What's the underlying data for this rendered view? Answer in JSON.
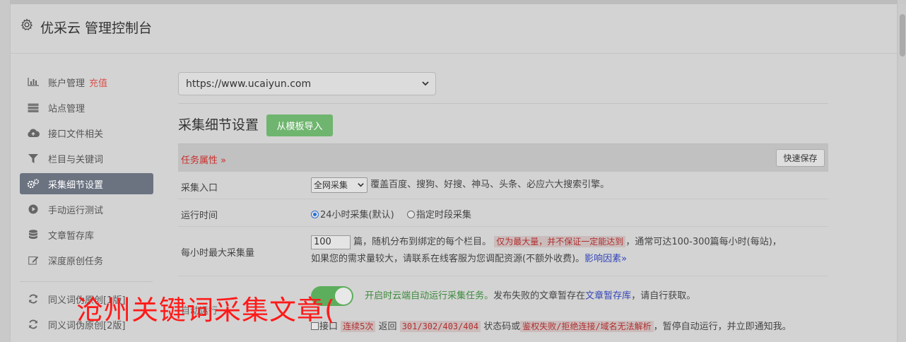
{
  "header": {
    "title": "优采云 管理控制台",
    "icon": "gear-icon"
  },
  "sidebar": {
    "items": [
      {
        "label": "账户管理",
        "badge": "充值",
        "icon": "bar-chart-icon"
      },
      {
        "label": "站点管理",
        "icon": "server-icon"
      },
      {
        "label": "接口文件相关",
        "icon": "cloud-upload-icon"
      },
      {
        "label": "栏目与关键词",
        "icon": "filter-icon"
      },
      {
        "label": "采集细节设置",
        "icon": "cogs-icon",
        "active": true
      },
      {
        "label": "手动运行测试",
        "icon": "play-circle-icon"
      },
      {
        "label": "文章暂存库",
        "icon": "database-icon"
      },
      {
        "label": "深度原创任务",
        "icon": "edit-icon"
      }
    ],
    "items2": [
      {
        "label": "同义词伪原创[1版]",
        "icon": "refresh-icon"
      },
      {
        "label": "同义词伪原创[2版]",
        "icon": "refresh-icon"
      }
    ]
  },
  "main": {
    "site_select": "https://www.ucaiyun.com",
    "section_title": "采集细节设置",
    "import_button": "从模板导入",
    "task_attr_label": "任务属性 »",
    "quick_save_button": "快速保存",
    "rows": {
      "entry": {
        "label": "采集入口",
        "select_value": "全网采集",
        "desc": "覆盖百度、搜狗、好搜、神马、头条、必应六大搜索引擎。"
      },
      "runtime": {
        "label": "运行时间",
        "option1": "24小时采集(默认)",
        "option2": "指定时段采集"
      },
      "max": {
        "label": "每小时最大采集量",
        "value": "100",
        "text1": "篇，随机分布到绑定的每个栏目。",
        "tag": "仅为最大量，并不保证一定能达到",
        "text2": "，通常可达100-300篇每小时(每站)，",
        "text3": "如果您的需求量较大，请联系在线客服为您调配资源(不额外收费)。",
        "link": "影响因素»"
      },
      "auto": {
        "label": "自动运行",
        "text_green": "开启时云端自动运行采集任务。",
        "text1": "发布失败的文章暂存在",
        "link": "文章暂存库",
        "text2": "，请自行获取。"
      },
      "pause": {
        "checkbox_label": "接口",
        "tag1": "连续5次",
        "text1": "返回",
        "tag2": "301/302/403/404",
        "text2": "状态码或",
        "tag3": "鉴权失败/拒绝连接/域名无法解析",
        "text3": "，暂停自动运行，并立即通知我。"
      }
    }
  },
  "watermark": "沧州关键词采集文章("
}
